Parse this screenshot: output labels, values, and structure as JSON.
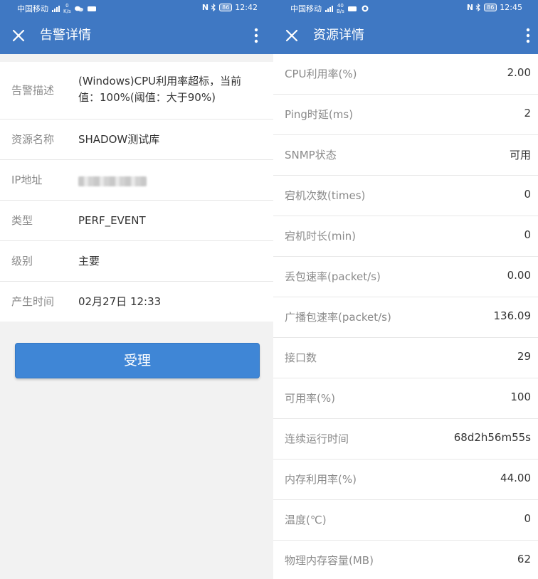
{
  "left_screen": {
    "status": {
      "carrier": "中国移动",
      "net_speed": "0",
      "net_unit": "K/s",
      "battery": "86",
      "time": "12:42"
    },
    "appbar": {
      "title": "告警详情"
    },
    "fields": [
      {
        "label": "告警描述",
        "value": "(Windows)CPU利用率超标，当前值：100%(阈值：大于90%)"
      },
      {
        "label": "资源名称",
        "value": "SHADOW测试库"
      },
      {
        "label": "IP地址",
        "value": ""
      },
      {
        "label": "类型",
        "value": "PERF_EVENT"
      },
      {
        "label": "级别",
        "value": "主要"
      },
      {
        "label": "产生时间",
        "value": "02月27日 12:33"
      }
    ],
    "accept_button": "受理"
  },
  "right_screen": {
    "status": {
      "carrier": "中国移动",
      "net_speed": "40",
      "net_unit": "B/s",
      "battery": "86",
      "time": "12:45"
    },
    "appbar": {
      "title": "资源详情"
    },
    "metrics": [
      {
        "label": "CPU利用率(%)",
        "value": "2.00"
      },
      {
        "label": "Ping时延(ms)",
        "value": "2"
      },
      {
        "label": "SNMP状态",
        "value": "可用"
      },
      {
        "label": "宕机次数(times)",
        "value": "0"
      },
      {
        "label": "宕机时长(min)",
        "value": "0"
      },
      {
        "label": "丢包速率(packet/s)",
        "value": "0.00"
      },
      {
        "label": "广播包速率(packet/s)",
        "value": "136.09"
      },
      {
        "label": "接口数",
        "value": "29"
      },
      {
        "label": "可用率(%)",
        "value": "100"
      },
      {
        "label": "连续运行时间",
        "value": "68d2h56m55s"
      },
      {
        "label": "内存利用率(%)",
        "value": "44.00"
      },
      {
        "label": "温度(℃)",
        "value": "0"
      },
      {
        "label": "物理内存容量(MB)",
        "value": "62"
      }
    ]
  },
  "colors": {
    "header": "#3f78c3",
    "button": "#3f86d6",
    "label": "#8a8a8a",
    "value": "#333333"
  },
  "icons": [
    "close-icon",
    "more-vert-icon",
    "nfc-icon",
    "bluetooth-icon",
    "battery-icon",
    "signal-icon",
    "wechat-icon"
  ]
}
